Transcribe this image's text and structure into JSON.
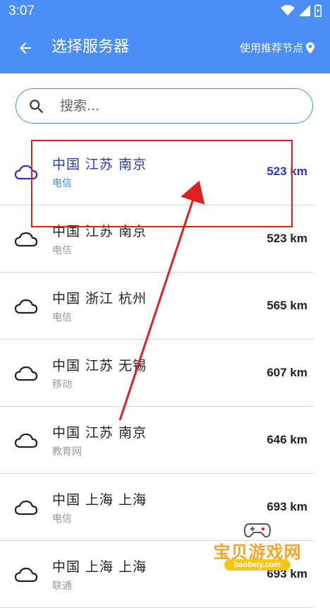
{
  "status_bar": {
    "time": "3:07"
  },
  "header": {
    "title": "选择服务器",
    "nearest_label": "使用推荐节点"
  },
  "search": {
    "placeholder": "搜索..."
  },
  "servers": [
    {
      "location": "中国 江苏 南京",
      "isp": "电信",
      "distance": "523 km",
      "selected": true
    },
    {
      "location": "中国 江苏 南京",
      "isp": "电信",
      "distance": "523 km",
      "selected": false
    },
    {
      "location": "中国 浙江 杭州",
      "isp": "电信",
      "distance": "565 km",
      "selected": false
    },
    {
      "location": "中国 江苏 无锡",
      "isp": "移动",
      "distance": "607 km",
      "selected": false
    },
    {
      "location": "中国 江苏 南京",
      "isp": "教育网",
      "distance": "646 km",
      "selected": false
    },
    {
      "location": "中国 上海 上海",
      "isp": "电信",
      "distance": "693 km",
      "selected": false
    },
    {
      "location": "中国 上海 上海",
      "isp": "联通",
      "distance": "693 km",
      "selected": false
    }
  ],
  "watermark": {
    "text": "宝贝游戏网",
    "url": "baobeiy.com"
  },
  "colors": {
    "accent": "#4b8ef7",
    "selected_text": "#2a35c8",
    "annotation": "#e02020"
  }
}
